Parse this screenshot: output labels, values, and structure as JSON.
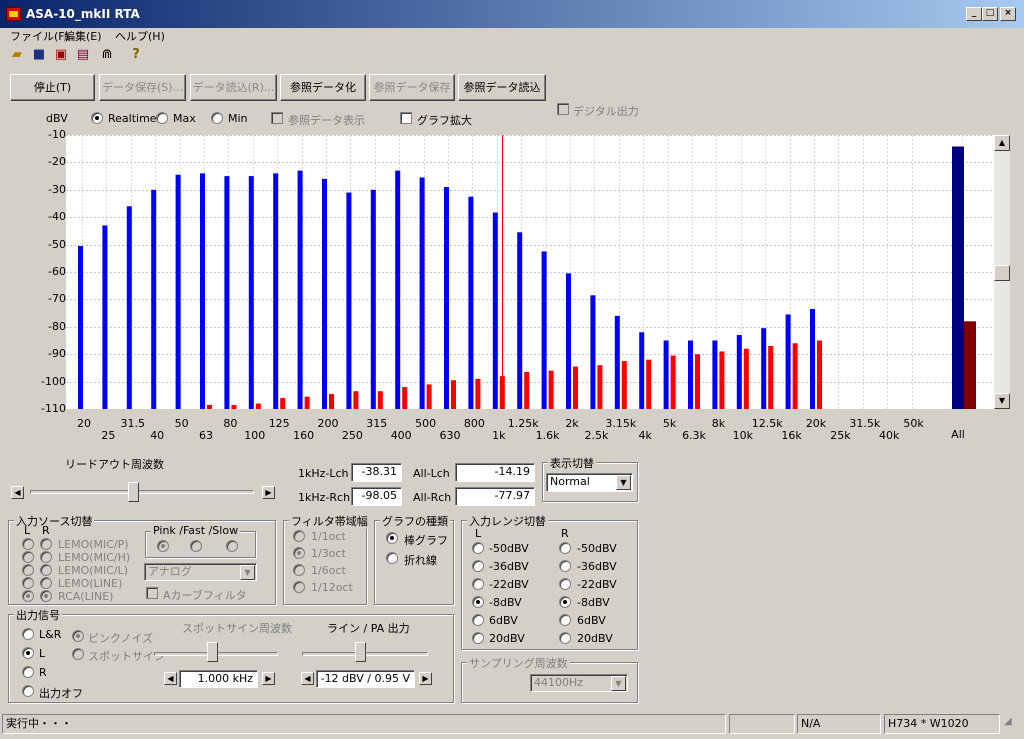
{
  "window": {
    "title": "ASA-10_mkII RTA"
  },
  "menu": [
    "ファイル(F)",
    "編集(E)",
    "ヘルプ(H)"
  ],
  "toolbar_icons": [
    "open-icon",
    "save-icon",
    "export-icon",
    "print-icon",
    "clip-icon",
    "help-icon"
  ],
  "buttons": {
    "stop": "停止(T)",
    "data_save": "データ保存(S)...",
    "data_load": "データ読込(R)...",
    "ref_data": "参照データ化",
    "ref_save": "参照データ保存",
    "ref_load": "参照データ読込"
  },
  "display": {
    "unit": "dBV",
    "realtime": "Realtime",
    "max": "Max",
    "min": "Min",
    "ref_display": "参照データ表示",
    "graph_zoom": "グラフ拡大",
    "digital_out": "デジタル出力"
  },
  "chart_data": {
    "type": "bar",
    "ylim": [
      -110,
      -10
    ],
    "yticks": [
      "-10",
      "-20",
      "-30",
      "-40",
      "-50",
      "-60",
      "-70",
      "-80",
      "-90",
      "-100",
      "-110"
    ],
    "grid": true,
    "categories": [
      "20",
      "25",
      "31.5",
      "40",
      "50",
      "63",
      "80",
      "100",
      "125",
      "160",
      "200",
      "250",
      "315",
      "400",
      "500",
      "630",
      "800",
      "1k",
      "1.25k",
      "1.6k",
      "2k",
      "2.5k",
      "3.15k",
      "4k",
      "5k",
      "6.3k",
      "8k",
      "10k",
      "12.5k",
      "16k",
      "20k",
      "25k",
      "31.5k",
      "40k",
      "50k",
      "All"
    ],
    "series": [
      {
        "name": "Lch",
        "color": "#0000ff",
        "values": [
          -50.5,
          -43,
          -36,
          -30,
          -24.5,
          -24,
          -25,
          -25,
          -24,
          -23,
          -26,
          -31,
          -30,
          -23,
          -25.5,
          -29,
          -32.5,
          -38.3,
          -45.5,
          -52.5,
          -60.5,
          -68.5,
          -76,
          -82,
          -85,
          -85,
          -85,
          -83,
          -80.5,
          -75.5,
          -73.5,
          null,
          null,
          null,
          null,
          -14.2
        ]
      },
      {
        "name": "Rch",
        "color": "#ff0000",
        "values": [
          null,
          null,
          null,
          null,
          -110,
          -108.5,
          -108.5,
          -108,
          -106,
          -105.5,
          -104.5,
          -103.5,
          -103.5,
          -102,
          -101,
          -99.5,
          -99,
          -98,
          -96.5,
          -96,
          -94.5,
          -94,
          -92.5,
          -92,
          -90.5,
          -90,
          -89,
          -88,
          -87,
          -86,
          -85,
          null,
          null,
          null,
          null,
          -78
        ]
      }
    ],
    "all_colors": [
      "#000080",
      "#800000"
    ],
    "marker_x": "1k"
  },
  "readout": {
    "k1_lch_label": "1kHz-Lch",
    "k1_lch": "-38.31",
    "k1_rch_label": "1kHz-Rch",
    "k1_rch": "-98.05",
    "all_lch_label": "All-Lch",
    "all_lch": "-14.19",
    "all_rch_label": "All-Rch",
    "all_rch": "-77.97"
  },
  "leadout": {
    "title": "リードアウト周波数",
    "level": 0.46
  },
  "display_switch": {
    "title": "表示切替",
    "value": "Normal"
  },
  "input_source": {
    "title": "入力ソース切替",
    "l": "L",
    "r": "R",
    "items": [
      "LEMO(MIC/P)",
      "LEMO(MIC/H)",
      "LEMO(MIC/L)",
      "LEMO(LINE)",
      "RCA(LINE)"
    ],
    "pink_title": "Pink /Fast /Slow",
    "analog": "アナログ",
    "a_filter": "Aカーブフィルタ"
  },
  "filter_bw": {
    "title": "フィルタ帯域幅",
    "items": [
      "1/1oct",
      "1/3oct",
      "1/6oct",
      "1/12oct"
    ]
  },
  "graph_type": {
    "title": "グラフの種類",
    "items": [
      "棒グラフ",
      "折れ線"
    ]
  },
  "input_range": {
    "title": "入力レンジ切替",
    "l": "L",
    "r": "R",
    "items": [
      "-50dBV",
      "-36dBV",
      "-22dBV",
      "-8dBV",
      "6dBV",
      "20dBV"
    ]
  },
  "output": {
    "title": "出力信号",
    "items": [
      "L&R",
      "L",
      "R",
      "出力オフ"
    ],
    "pink": "ピンクノイズ",
    "spot": "スポットサイン",
    "spot_freq_title": "スポットサイン周波数",
    "spot_freq": "1.000 kHz",
    "spot_level": 0.47,
    "line_title": "ライン / PA 出力",
    "line_value": "-12 dBV / 0.95 V",
    "line_level": 0.46
  },
  "sampling": {
    "title": "サンプリング周波数",
    "value": "44100Hz"
  },
  "statusbar": {
    "text": "実行中・・・",
    "na": "N/A",
    "size": "H734 * W1020"
  }
}
